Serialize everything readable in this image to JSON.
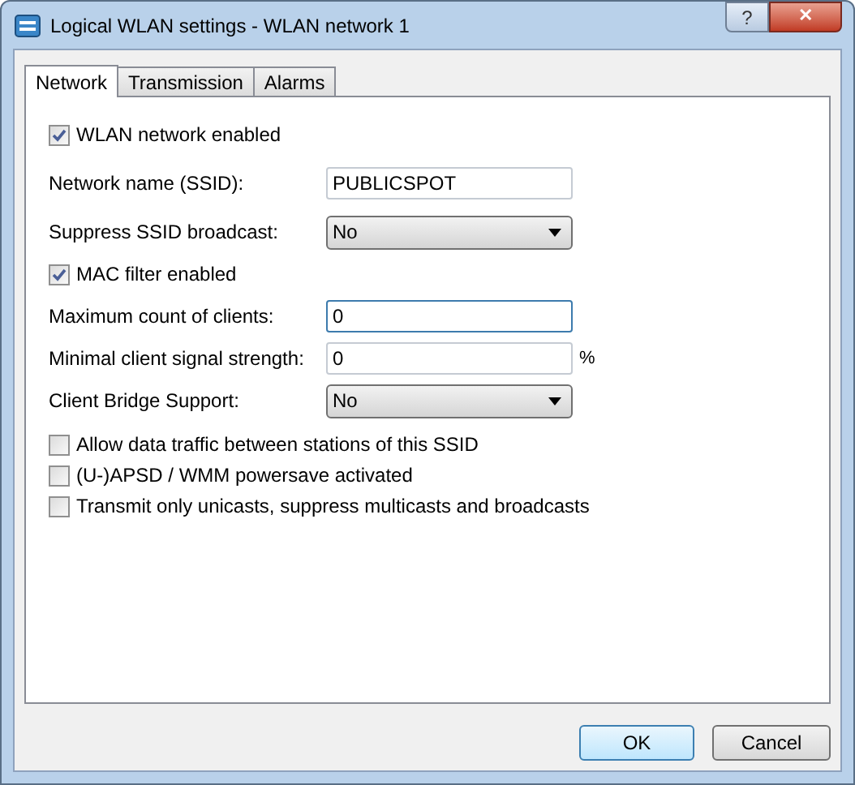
{
  "window": {
    "title": "Logical WLAN settings - WLAN network 1",
    "help": "?",
    "close": "✕"
  },
  "tabs": [
    {
      "label": "Network",
      "selected": true
    },
    {
      "label": "Transmission",
      "selected": false
    },
    {
      "label": "Alarms",
      "selected": false
    }
  ],
  "fields": [
    {
      "kind": "checkbox",
      "label": "WLAN network enabled",
      "checked": true
    },
    {
      "kind": "text",
      "label": "Network name (SSID):",
      "value": "PUBLICSPOT",
      "focused": false
    },
    {
      "kind": "select",
      "label": "Suppress SSID broadcast:",
      "value": "No"
    },
    {
      "kind": "checkbox",
      "label": "MAC filter enabled",
      "checked": true
    },
    {
      "kind": "text",
      "label": "Maximum count of clients:",
      "value": "0",
      "focused": true
    },
    {
      "kind": "text",
      "label": "Minimal client signal strength:",
      "value": "0",
      "focused": false,
      "unit": "%"
    },
    {
      "kind": "select",
      "label": "Client Bridge Support:",
      "value": "No"
    },
    {
      "kind": "checkbox",
      "label": "Allow data traffic between stations of this SSID",
      "checked": false
    },
    {
      "kind": "checkbox",
      "label": "(U-)APSD / WMM powersave activated",
      "checked": false
    },
    {
      "kind": "checkbox",
      "label": "Transmit only unicasts, suppress multicasts and broadcasts",
      "checked": false
    }
  ],
  "buttons": [
    {
      "label": "OK",
      "default": true
    },
    {
      "label": "Cancel",
      "default": false
    }
  ]
}
